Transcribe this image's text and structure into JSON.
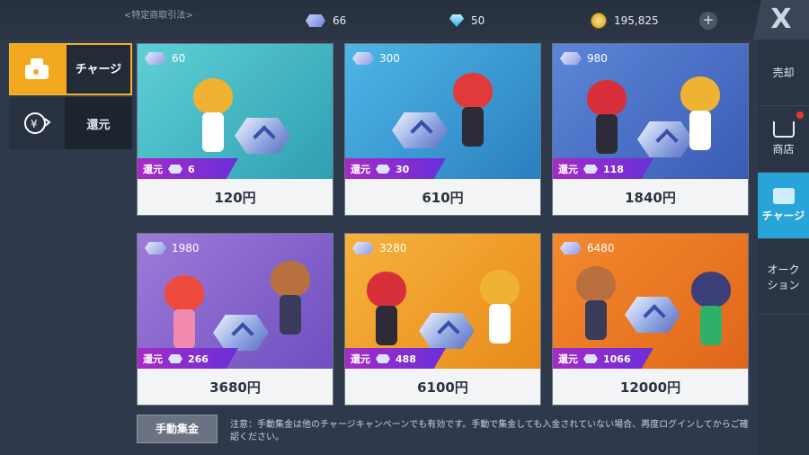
{
  "header": {
    "legal_link": "<特定商取引法>",
    "currencies": [
      {
        "icon": "crystal-icon",
        "value": "66"
      },
      {
        "icon": "diamond-icon",
        "value": "50"
      },
      {
        "icon": "coin-icon",
        "value": "195,825"
      }
    ],
    "add_label": "+",
    "close_label": "X"
  },
  "left_tabs": [
    {
      "label": "チャージ",
      "icon": "wallet-icon",
      "active": true
    },
    {
      "label": "還元",
      "icon": "yen-refund-icon",
      "active": false
    }
  ],
  "right_tabs": [
    {
      "label": "売却",
      "active": false
    },
    {
      "label": "商店",
      "active": false,
      "has_notification": true
    },
    {
      "label": "チャージ",
      "active": true
    },
    {
      "label": "オーク\nション",
      "active": false
    }
  ],
  "bonus_label": "還元",
  "packs": [
    {
      "amount": "60",
      "bonus": "6",
      "price": "120円"
    },
    {
      "amount": "300",
      "bonus": "30",
      "price": "610円"
    },
    {
      "amount": "980",
      "bonus": "118",
      "price": "1840円"
    },
    {
      "amount": "1980",
      "bonus": "266",
      "price": "3680円"
    },
    {
      "amount": "3280",
      "bonus": "488",
      "price": "6100円"
    },
    {
      "amount": "6480",
      "bonus": "1066",
      "price": "12000円"
    }
  ],
  "footer": {
    "manual_button": "手動集金",
    "notice": "注意：手動集金は他のチャージキャンペーンでも有効です。手動で集金しても入金されていない場合、再度ログインしてからご確認ください。"
  },
  "colors": {
    "accent_orange": "#f2a81e",
    "active_blue": "#27a4d8",
    "bonus_purple": "#8a2fd0"
  }
}
